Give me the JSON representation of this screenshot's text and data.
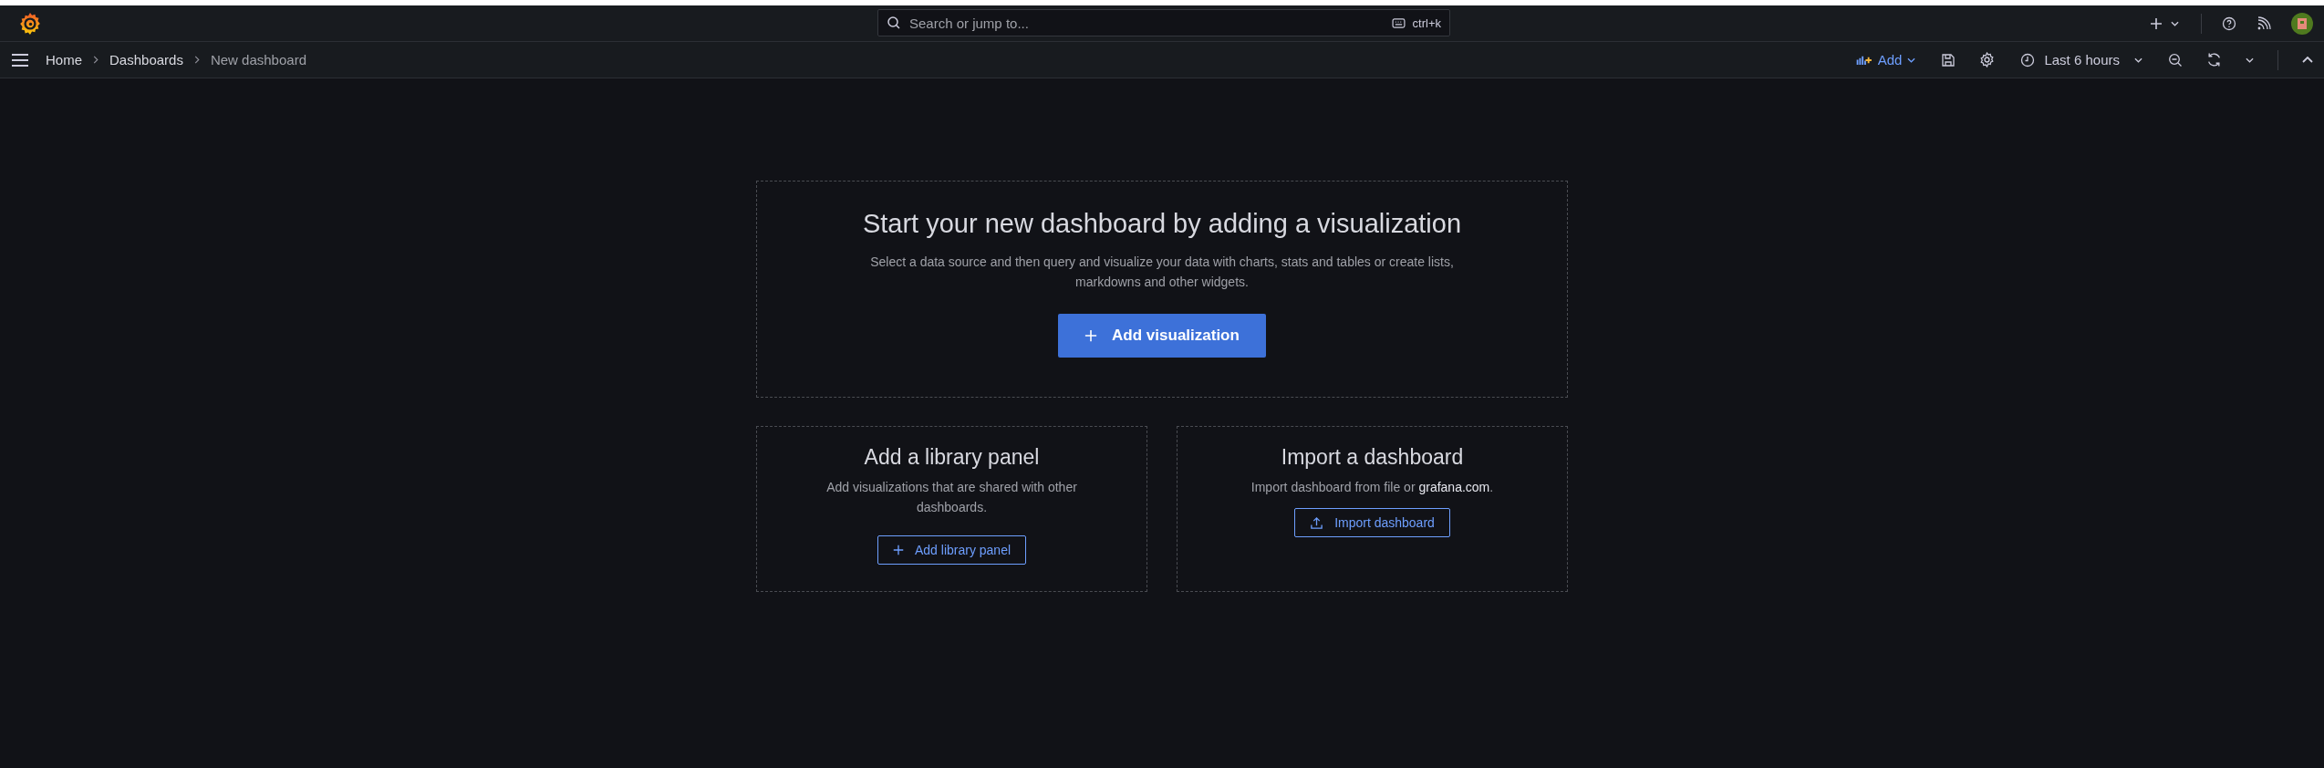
{
  "topbar": {
    "search": {
      "placeholder": "Search or jump to...",
      "shortcut": "ctrl+k"
    }
  },
  "breadcrumbs": [
    {
      "label": "Home",
      "current": false
    },
    {
      "label": "Dashboards",
      "current": false
    },
    {
      "label": "New dashboard",
      "current": true
    }
  ],
  "toolbar": {
    "add": "Add",
    "time_range": "Last 6 hours"
  },
  "empty_state": {
    "title": "Start your new dashboard by adding a visualization",
    "description": "Select a data source and then query and visualize your data with charts, stats and tables or create lists, markdowns and other widgets.",
    "button": "Add visualization"
  },
  "library_panel": {
    "title": "Add a library panel",
    "description": "Add visualizations that are shared with other dashboards.",
    "button": "Add library panel"
  },
  "import": {
    "title": "Import a dashboard",
    "description_before": "Import dashboard from file or ",
    "link": "grafana.com",
    "description_after": ".",
    "button": "Import dashboard"
  }
}
